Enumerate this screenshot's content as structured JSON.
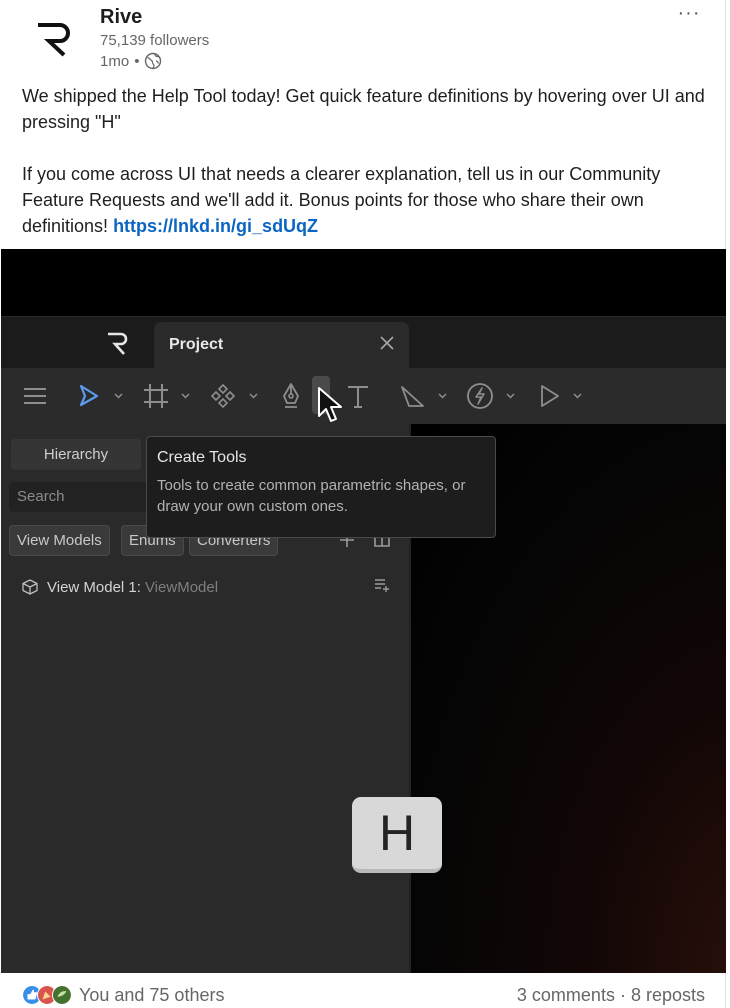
{
  "post": {
    "company_name": "Rive",
    "followers": "75,139 followers",
    "time_ago": "1mo",
    "dot": "•",
    "more_label": "···",
    "text_line1": "We shipped the Help Tool today! Get quick feature definitions by hovering over UI and pressing \"H\"",
    "text_line2": "If you come across UI that needs a clearer explanation, tell us in our Community Feature Requests and we'll add it. Bonus points for those who share their own definitions! ",
    "link": "https://lnkd.in/gi_sdUqZ"
  },
  "app": {
    "tab_title": "Project",
    "sidebar": {
      "hierarchy": "Hierarchy",
      "search_placeholder": "Search",
      "chips": [
        "View Models",
        "Enums",
        "Converters"
      ],
      "view_model_name": "View Model 1:",
      "view_model_type": "ViewModel"
    },
    "tooltip": {
      "title": "Create Tools",
      "body": "Tools to create common parametric shapes, or draw your own custom ones."
    },
    "key_label": "H",
    "accent_color": "#5b9bf0"
  },
  "footer": {
    "reactions_text": "You and 75 others",
    "comments": "3 comments",
    "separator": "·",
    "reposts": "8 reposts"
  }
}
